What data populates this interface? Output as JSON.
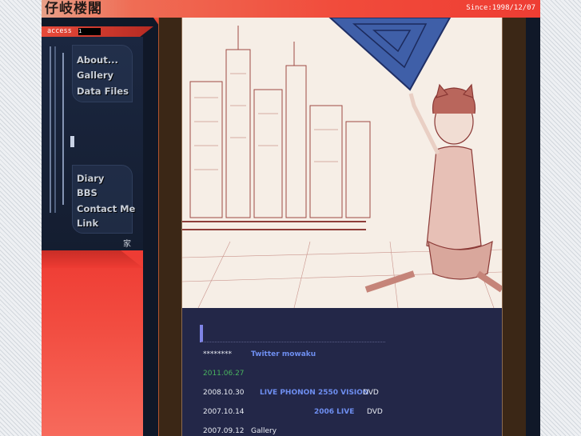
{
  "header": {
    "logo_text": "仔岐楼閣",
    "since": "Since:1998/12/07",
    "access_label": "access",
    "access_count": "1"
  },
  "sidebar": {
    "nav_top": [
      "About...",
      "Gallery",
      "Data Files"
    ],
    "nav_bottom": [
      "Diary",
      "BBS",
      "Contact Me",
      "Link"
    ],
    "home_glyph": "家"
  },
  "news": [
    {
      "date": "********",
      "link": "Twitter mowaku",
      "suffix": ""
    },
    {
      "date": "2011.06.27",
      "link": "",
      "suffix": ""
    },
    {
      "date": "2008.10.30",
      "link": "LIVE  PHONON 2550 VISION",
      "suffix": "DVD"
    },
    {
      "date": "2007.10.14",
      "link": "2006  LIVE",
      "suffix": "DVD"
    },
    {
      "date": "2007.09.12",
      "link": "",
      "suffix": "Gallery"
    }
  ],
  "colors": {
    "header_red": "#f14b3b",
    "sidebar_navy": "#1b2740",
    "content_navy": "#232748",
    "link_blue": "#6e8ef0",
    "date_green": "#49b35e"
  }
}
